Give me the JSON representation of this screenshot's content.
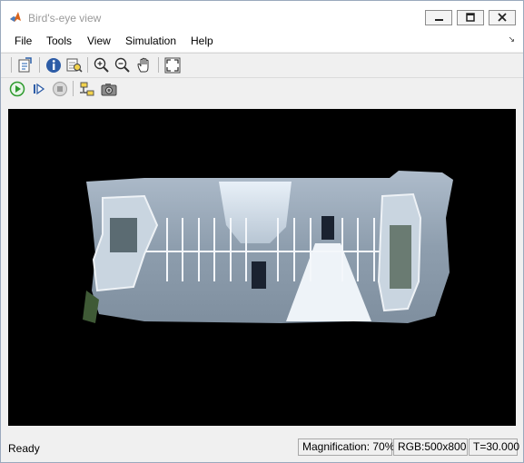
{
  "window": {
    "title": "Bird's-eye view"
  },
  "menu": {
    "items": [
      "File",
      "Tools",
      "View",
      "Simulation",
      "Help"
    ]
  },
  "toolbar": {
    "row1": [
      "open-icon",
      "info-icon",
      "inspect-icon",
      "zoom-in-icon",
      "zoom-out-icon",
      "pan-hand-icon",
      "fit-to-view-icon"
    ],
    "row2": [
      "run-icon",
      "step-forward-icon",
      "stop-icon",
      "signal-selection-icon",
      "snapshot-icon"
    ]
  },
  "status": {
    "state": "Ready",
    "magnification": "Magnification: 70%",
    "image_info": "RGB:500x800",
    "time": "T=30.000"
  },
  "colors": {
    "viewport_bg": "#000000",
    "play_green": "#2e9b2e",
    "title_text": "#9a9a9a"
  }
}
